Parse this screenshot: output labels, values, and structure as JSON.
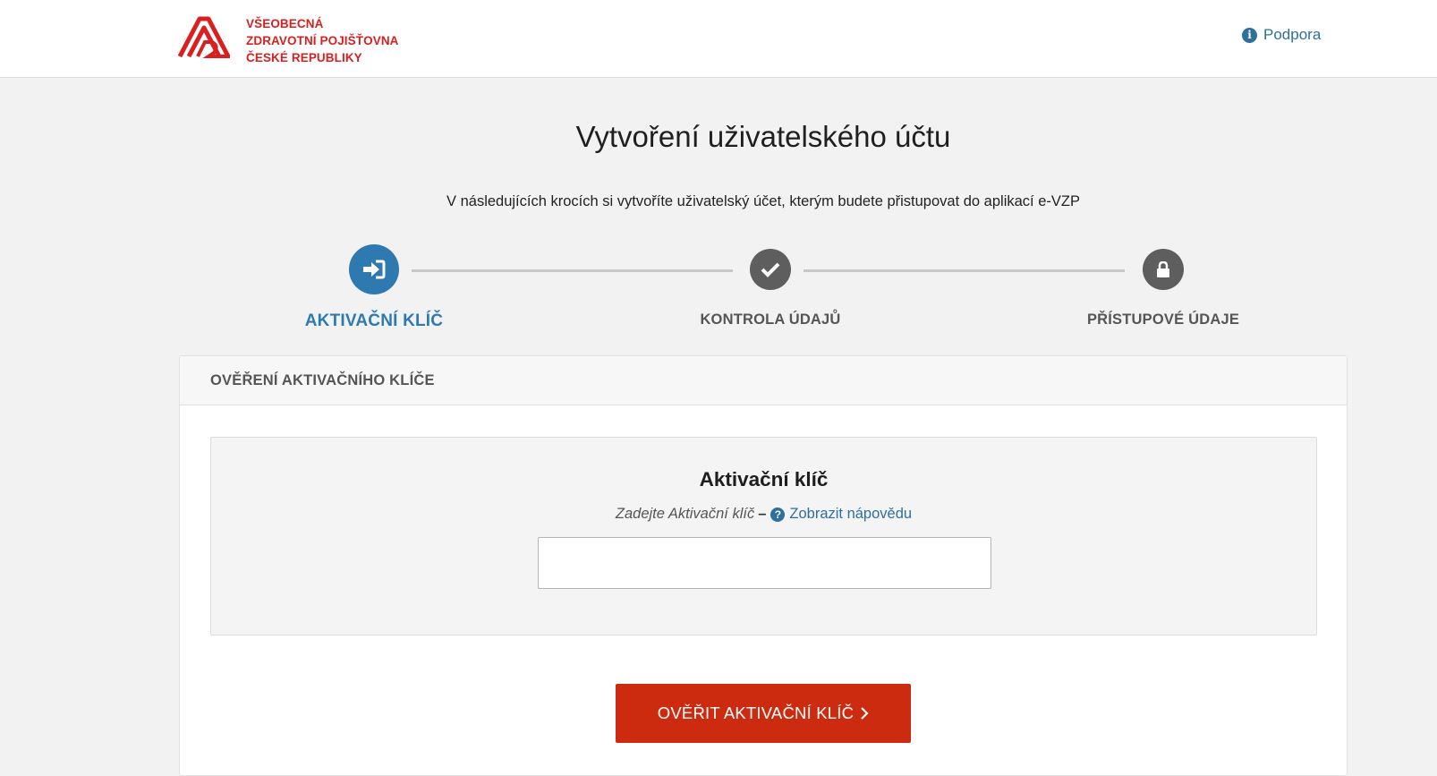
{
  "header": {
    "logo_lines": [
      "VŠEOBECNÁ",
      "ZDRAVOTNÍ POJIŠŤOVNA",
      "ČESKÉ REPUBLIKY"
    ],
    "brand_color": "#d92020",
    "support_label": "Podpora",
    "support_icon": "info-icon"
  },
  "page": {
    "title": "Vytvoření uživatelského účtu",
    "subtitle": "V následujících krocích si vytvoříte uživatelský účet, kterým budete přistupovat do aplikací e-VZP"
  },
  "steps": [
    {
      "label": "AKTIVAČNÍ KLÍČ",
      "icon": "sign-in-icon",
      "state": "active"
    },
    {
      "label": "KONTROLA ÚDAJŮ",
      "icon": "check-icon",
      "state": "inactive"
    },
    {
      "label": "PŘÍSTUPOVÉ ÚDAJE",
      "icon": "lock-icon",
      "state": "inactive"
    }
  ],
  "card": {
    "header": "OVĚŘENÍ AKTIVAČNÍHO KLÍČE",
    "key_title": "Aktivační klíč",
    "hint_text": "Zadejte Aktivační klíč",
    "hint_dash": "–",
    "help_link": "Zobrazit nápovědu",
    "input_value": "",
    "input_placeholder": "",
    "verify_button": "OVĚŘIT AKTIVAČNÍ KLÍČ"
  },
  "colors": {
    "accent_blue": "#2e7ab0",
    "link_blue": "#2e6f9e",
    "button_red": "#cc2b10",
    "inactive_step": "#5e5e5e"
  }
}
